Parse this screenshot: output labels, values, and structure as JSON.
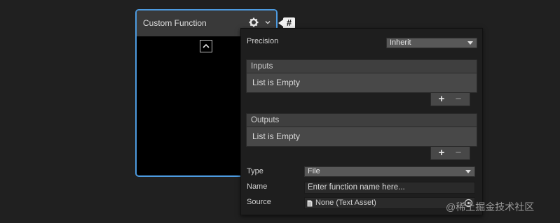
{
  "node": {
    "title": "Custom Function",
    "border_color": "#4d9be0"
  },
  "hash_badge": "#",
  "panel": {
    "precision_label": "Precision",
    "precision_value": "Inherit",
    "inputs_header": "Inputs",
    "inputs_empty": "List is Empty",
    "outputs_header": "Outputs",
    "outputs_empty": "List is Empty",
    "add_symbol": "+",
    "remove_symbol": "−",
    "type_label": "Type",
    "type_value": "File",
    "name_label": "Name",
    "name_placeholder": "Enter function name here...",
    "source_label": "Source",
    "source_value": "None (Text Asset)"
  },
  "watermark": "@稀土掘金技术社区",
  "icons": {
    "settings": "gear-icon",
    "dropdown": "chevron-down-icon",
    "collapse": "chevron-up-icon",
    "source_file": "document-icon",
    "object_picker": "target-icon"
  }
}
